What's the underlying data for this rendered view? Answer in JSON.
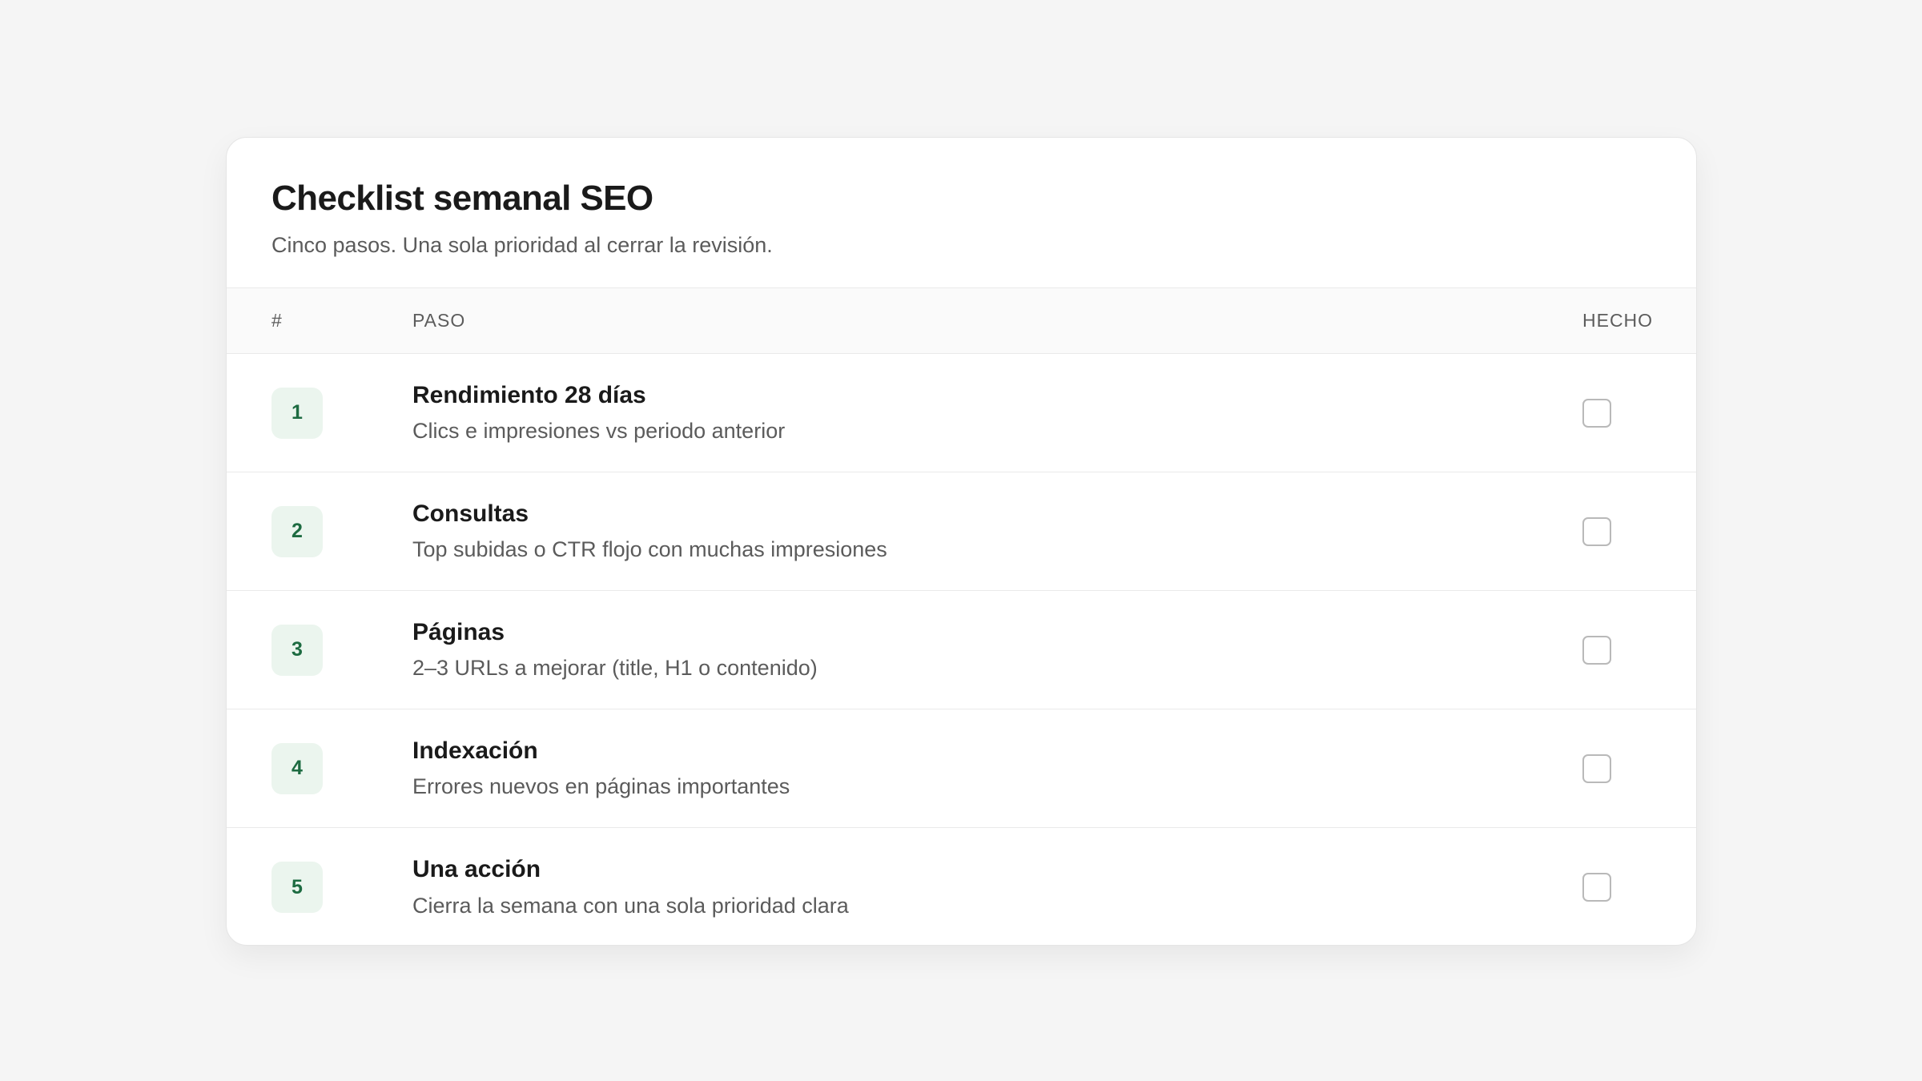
{
  "card": {
    "title": "Checklist semanal SEO",
    "subtitle": "Cinco pasos. Una sola prioridad al cerrar la revisión."
  },
  "table": {
    "headers": {
      "num": "#",
      "step": "PASO",
      "done": "HECHO"
    },
    "rows": [
      {
        "num": "1",
        "title": "Rendimiento 28 días",
        "desc": "Clics e impresiones vs periodo anterior",
        "done": false
      },
      {
        "num": "2",
        "title": "Consultas",
        "desc": "Top subidas o CTR flojo con muchas impresiones",
        "done": false
      },
      {
        "num": "3",
        "title": "Páginas",
        "desc": "2–3 URLs a mejorar (title, H1 o contenido)",
        "done": false
      },
      {
        "num": "4",
        "title": "Indexación",
        "desc": "Errores nuevos en páginas importantes",
        "done": false
      },
      {
        "num": "5",
        "title": "Una acción",
        "desc": "Cierra la semana con una sola prioridad clara",
        "done": false
      }
    ]
  },
  "colors": {
    "accent": "#1d6b41",
    "badge_bg": "#ebf5ee",
    "page_bg": "#f5f5f5"
  }
}
